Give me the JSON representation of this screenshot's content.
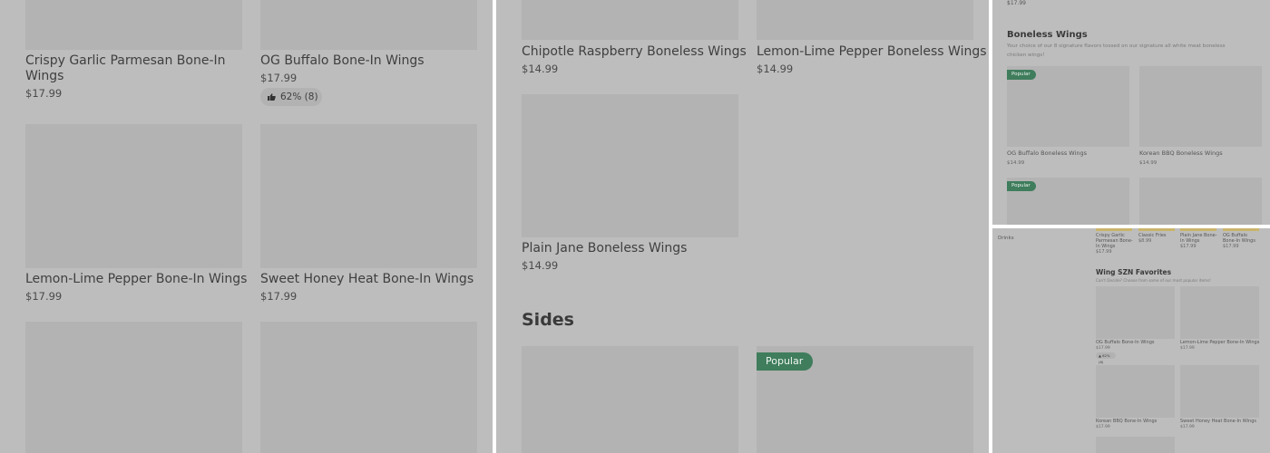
{
  "panel1": {
    "items": [
      {
        "name": "Crispy Garlic Parmesan Bone-In Wings",
        "price": "$17.99"
      },
      {
        "name": "OG Buffalo Bone-In Wings",
        "price": "$17.99",
        "rating": "62% (8)"
      },
      {
        "name": "Lemon-Lime Pepper Bone-In Wings",
        "price": "$17.99"
      },
      {
        "name": "Sweet Honey Heat Bone-In Wings",
        "price": "$17.99"
      }
    ]
  },
  "panel2": {
    "items": [
      {
        "name": "Chipotle Raspberry Boneless Wings",
        "price": "$14.99"
      },
      {
        "name": "Lemon-Lime Pepper Boneless Wings",
        "price": "$14.99"
      },
      {
        "name": "Plain Jane Boneless Wings",
        "price": "$14.99"
      }
    ],
    "section_title": "Sides",
    "popular_badge": "Popular"
  },
  "panel3": {
    "top_price": "$17.99",
    "section_title": "Boneless Wings",
    "section_desc_line1": "Your choice of our 8 signature flavors tossed on our signature all white meat boneless",
    "section_desc_line2": "chicken wings!",
    "popular_badge": "Popular",
    "items": [
      {
        "name": "OG Buffalo Boneless Wings",
        "price": "$14.99"
      },
      {
        "name": "Korean BBQ Boneless Wings",
        "price": "$14.99"
      }
    ]
  },
  "panel4": {
    "sidebar_item": "Drinks",
    "strip": [
      {
        "name": [
          "Crispy Garlic",
          "Parmesan Bone-",
          "In Wings"
        ],
        "price": "$17.99"
      },
      {
        "name": [
          "Classic Fries"
        ],
        "price": "$8.99"
      },
      {
        "name": [
          "Plain Jane Bone-",
          "In Wings"
        ],
        "price": "$17.99"
      },
      {
        "name": [
          "OG Buffalo",
          "Bone-In Wings"
        ],
        "price": "$17.99"
      }
    ],
    "section_title": "Wing SZN Favorites",
    "section_desc": "Can't Decide? Choose from some of our most popular items!",
    "items": [
      {
        "name": "OG Buffalo Bone-In Wings",
        "price": "$17.99",
        "rating": "62% (8)"
      },
      {
        "name": "Lemon-Lime Pepper Bone-In Wings",
        "price": "$17.99"
      },
      {
        "name": "Korean BBQ Bone-In Wings",
        "price": "$17.99"
      },
      {
        "name": "Sweet Honey Heat Bone-In Wings",
        "price": "$17.99"
      }
    ]
  },
  "colors": {
    "overlay": "#bdbdbd",
    "placeholder": "#b3b3b3",
    "badge": "#3f7d5c"
  },
  "icons": {
    "rating": "thumbs-up-icon"
  }
}
